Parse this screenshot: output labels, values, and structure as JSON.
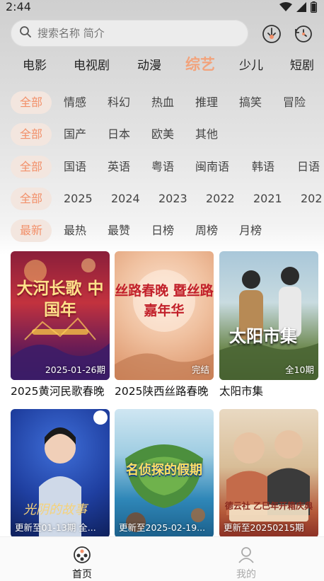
{
  "status": {
    "time": "2:44"
  },
  "search": {
    "placeholder": "搜索名称 简介"
  },
  "categories": [
    {
      "label": "电影"
    },
    {
      "label": "电视剧"
    },
    {
      "label": "动漫"
    },
    {
      "label": "综艺",
      "active": true
    },
    {
      "label": "少儿"
    },
    {
      "label": "短剧"
    }
  ],
  "filters": {
    "genre": [
      "全部",
      "情感",
      "科幻",
      "热血",
      "推理",
      "搞笑",
      "冒险"
    ],
    "region": [
      "全部",
      "国产",
      "日本",
      "欧美",
      "其他"
    ],
    "language": [
      "全部",
      "国语",
      "英语",
      "粤语",
      "闽南语",
      "韩语",
      "日语"
    ],
    "year": [
      "全部",
      "2025",
      "2024",
      "2023",
      "2022",
      "2021",
      "202"
    ],
    "sort": [
      "最新",
      "最热",
      "最赞",
      "日榜",
      "周榜",
      "月榜"
    ]
  },
  "cards": [
    {
      "title": "2025黄河民歌春晚",
      "badge": "2025-01-26期",
      "poster_text": "大河长歌 中国年"
    },
    {
      "title": "2025陕西丝路春晚",
      "badge": "完结",
      "poster_text": "丝路春晚 暨丝路嘉年华"
    },
    {
      "title": "太阳市集",
      "badge": "全10期",
      "poster_text": "太阳市集"
    },
    {
      "title": "",
      "badge": "更新至01-13期 全...",
      "poster_text": "光阴的故事"
    },
    {
      "title": "",
      "badge": "更新至2025-02-19...",
      "poster_text": "名侦探的假期"
    },
    {
      "title": "",
      "badge": "更新至20250215期",
      "poster_text": "德云社 乙巳年开箱庆典"
    }
  ],
  "tabbar": {
    "home": "首页",
    "mine": "我的"
  },
  "colors": {
    "accent": "#f2a37c",
    "chip_bg": "#f3e6df"
  }
}
